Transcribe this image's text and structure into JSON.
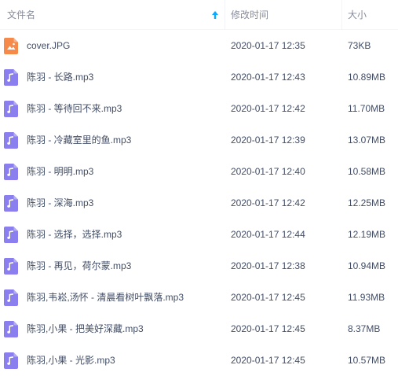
{
  "header": {
    "name_label": "文件名",
    "date_label": "修改时间",
    "size_label": "大小",
    "sort_direction": "ascending"
  },
  "colors": {
    "image_icon": "#f58a4b",
    "audio_icon": "#8b7ff0",
    "text": "#424e67",
    "header_text": "#878c9c",
    "sort_arrow": "#09aaff"
  },
  "files": [
    {
      "name": "cover.JPG",
      "modified": "2020-01-17 12:35",
      "size": "73KB",
      "icon": "image-file-icon"
    },
    {
      "name": "陈羽 - 长路.mp3",
      "modified": "2020-01-17 12:43",
      "size": "10.89MB",
      "icon": "audio-file-icon"
    },
    {
      "name": "陈羽 - 等待回不来.mp3",
      "modified": "2020-01-17 12:42",
      "size": "11.70MB",
      "icon": "audio-file-icon"
    },
    {
      "name": "陈羽 - 冷藏室里的鱼.mp3",
      "modified": "2020-01-17 12:39",
      "size": "13.07MB",
      "icon": "audio-file-icon"
    },
    {
      "name": "陈羽 - 明明.mp3",
      "modified": "2020-01-17 12:40",
      "size": "10.58MB",
      "icon": "audio-file-icon"
    },
    {
      "name": "陈羽 - 深海.mp3",
      "modified": "2020-01-17 12:42",
      "size": "12.25MB",
      "icon": "audio-file-icon"
    },
    {
      "name": "陈羽 - 选择，选择.mp3",
      "modified": "2020-01-17 12:44",
      "size": "12.19MB",
      "icon": "audio-file-icon"
    },
    {
      "name": "陈羽 - 再见，荷尔蒙.mp3",
      "modified": "2020-01-17 12:38",
      "size": "10.94MB",
      "icon": "audio-file-icon"
    },
    {
      "name": "陈羽,韦崧,汤怀 - 清晨看树叶飘落.mp3",
      "modified": "2020-01-17 12:45",
      "size": "11.93MB",
      "icon": "audio-file-icon"
    },
    {
      "name": "陈羽,小果 - 把美好深藏.mp3",
      "modified": "2020-01-17 12:45",
      "size": "8.37MB",
      "icon": "audio-file-icon"
    },
    {
      "name": "陈羽,小果 - 光影.mp3",
      "modified": "2020-01-17 12:45",
      "size": "10.57MB",
      "icon": "audio-file-icon"
    }
  ]
}
